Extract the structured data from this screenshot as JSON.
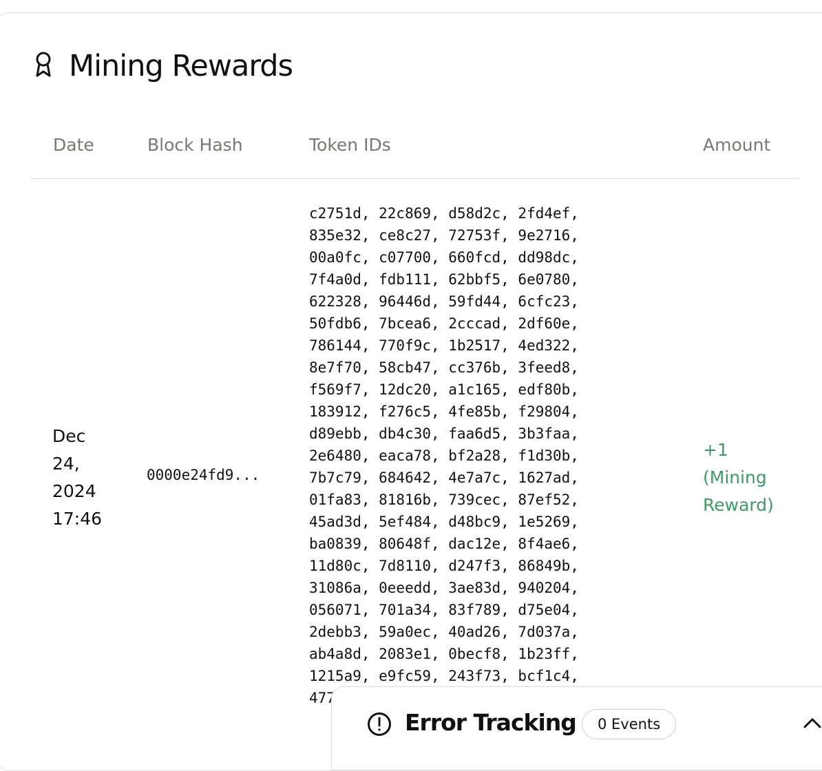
{
  "page": {
    "title": "Mining Rewards",
    "title_icon": "award-ribbon-icon"
  },
  "table": {
    "headers": {
      "date": "Date",
      "block_hash": "Block Hash",
      "token_ids": "Token IDs",
      "amount": "Amount"
    },
    "rows": [
      {
        "date": "Dec 24, 2024 17:46",
        "block_hash": "0000e24fd9...",
        "token_ids": "c2751d, 22c869, d58d2c, 2fd4ef, 835e32, ce8c27, 72753f, 9e2716, 00a0fc, c07700, 660fcd, dd98dc, 7f4a0d, fdb111, 62bbf5, 6e0780, 622328, 96446d, 59fd44, 6cfc23, 50fdb6, 7bcea6, 2cccad, 2df60e, 786144, 770f9c, 1b2517, 4ed322, 8e7f70, 58cb47, cc376b, 3feed8, f569f7, 12dc20, a1c165, edf80b, 183912, f276c5, 4fe85b, f29804, d89ebb, db4c30, faa6d5, 3b3faa, 2e6480, eaca78, bf2a28, f1d30b, 7b7c79, 684642, 4e7a7c, 1627ad, 01fa83, 81816b, 739cec, 87ef52, 45ad3d, 5ef484, d48bc9, 1e5269, ba0839, 80648f, dac12e, 8f4ae6, 11d80c, 7d8110, d247f3, 86849b, 31086a, 0eeedd, 3ae83d, 940204, 056071, 701a34, 83f789, d75e04, 2debb3, 59a0ec, 40ad26, 7d037a, ab4a8d, 2083e1, 0becf8, 1b23ff, 1215a9, e9fc59, 243f73, bcf1c4, 477",
        "amount": "+1 (Mining Reward)"
      }
    ]
  },
  "error_panel": {
    "title": "Error Tracking",
    "events_badge": "0 Events",
    "icon": "alert-circle-icon",
    "toggle_icon": "chevron-up-icon"
  },
  "colors": {
    "amount_positive": "#3d9b63",
    "header_text": "#7b7670",
    "border": "#dedede"
  }
}
